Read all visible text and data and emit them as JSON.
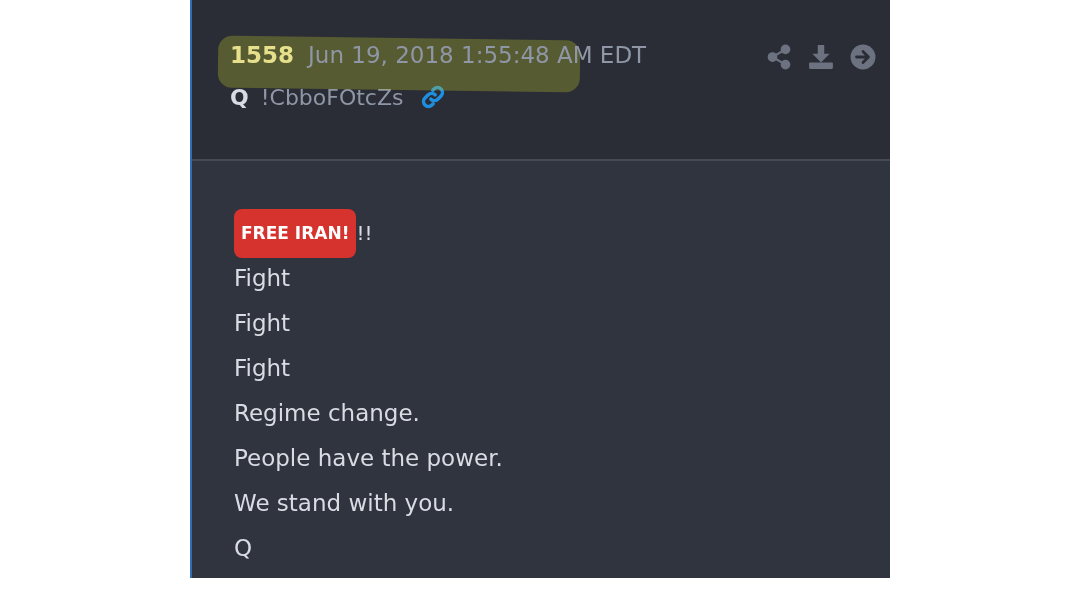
{
  "post": {
    "number": "1558",
    "timestamp": "Jun 19, 2018 1:55:48 AM EDT",
    "highlighted": true,
    "author": "Q",
    "tripcode": "!CbboFOtcZs",
    "badge": "FREE IRAN!",
    "badge_suffix": "!!",
    "lines": [
      "Fight",
      "Fight",
      "Fight",
      "Regime change.",
      "People have the power.",
      "We stand with you.",
      "Q"
    ]
  }
}
